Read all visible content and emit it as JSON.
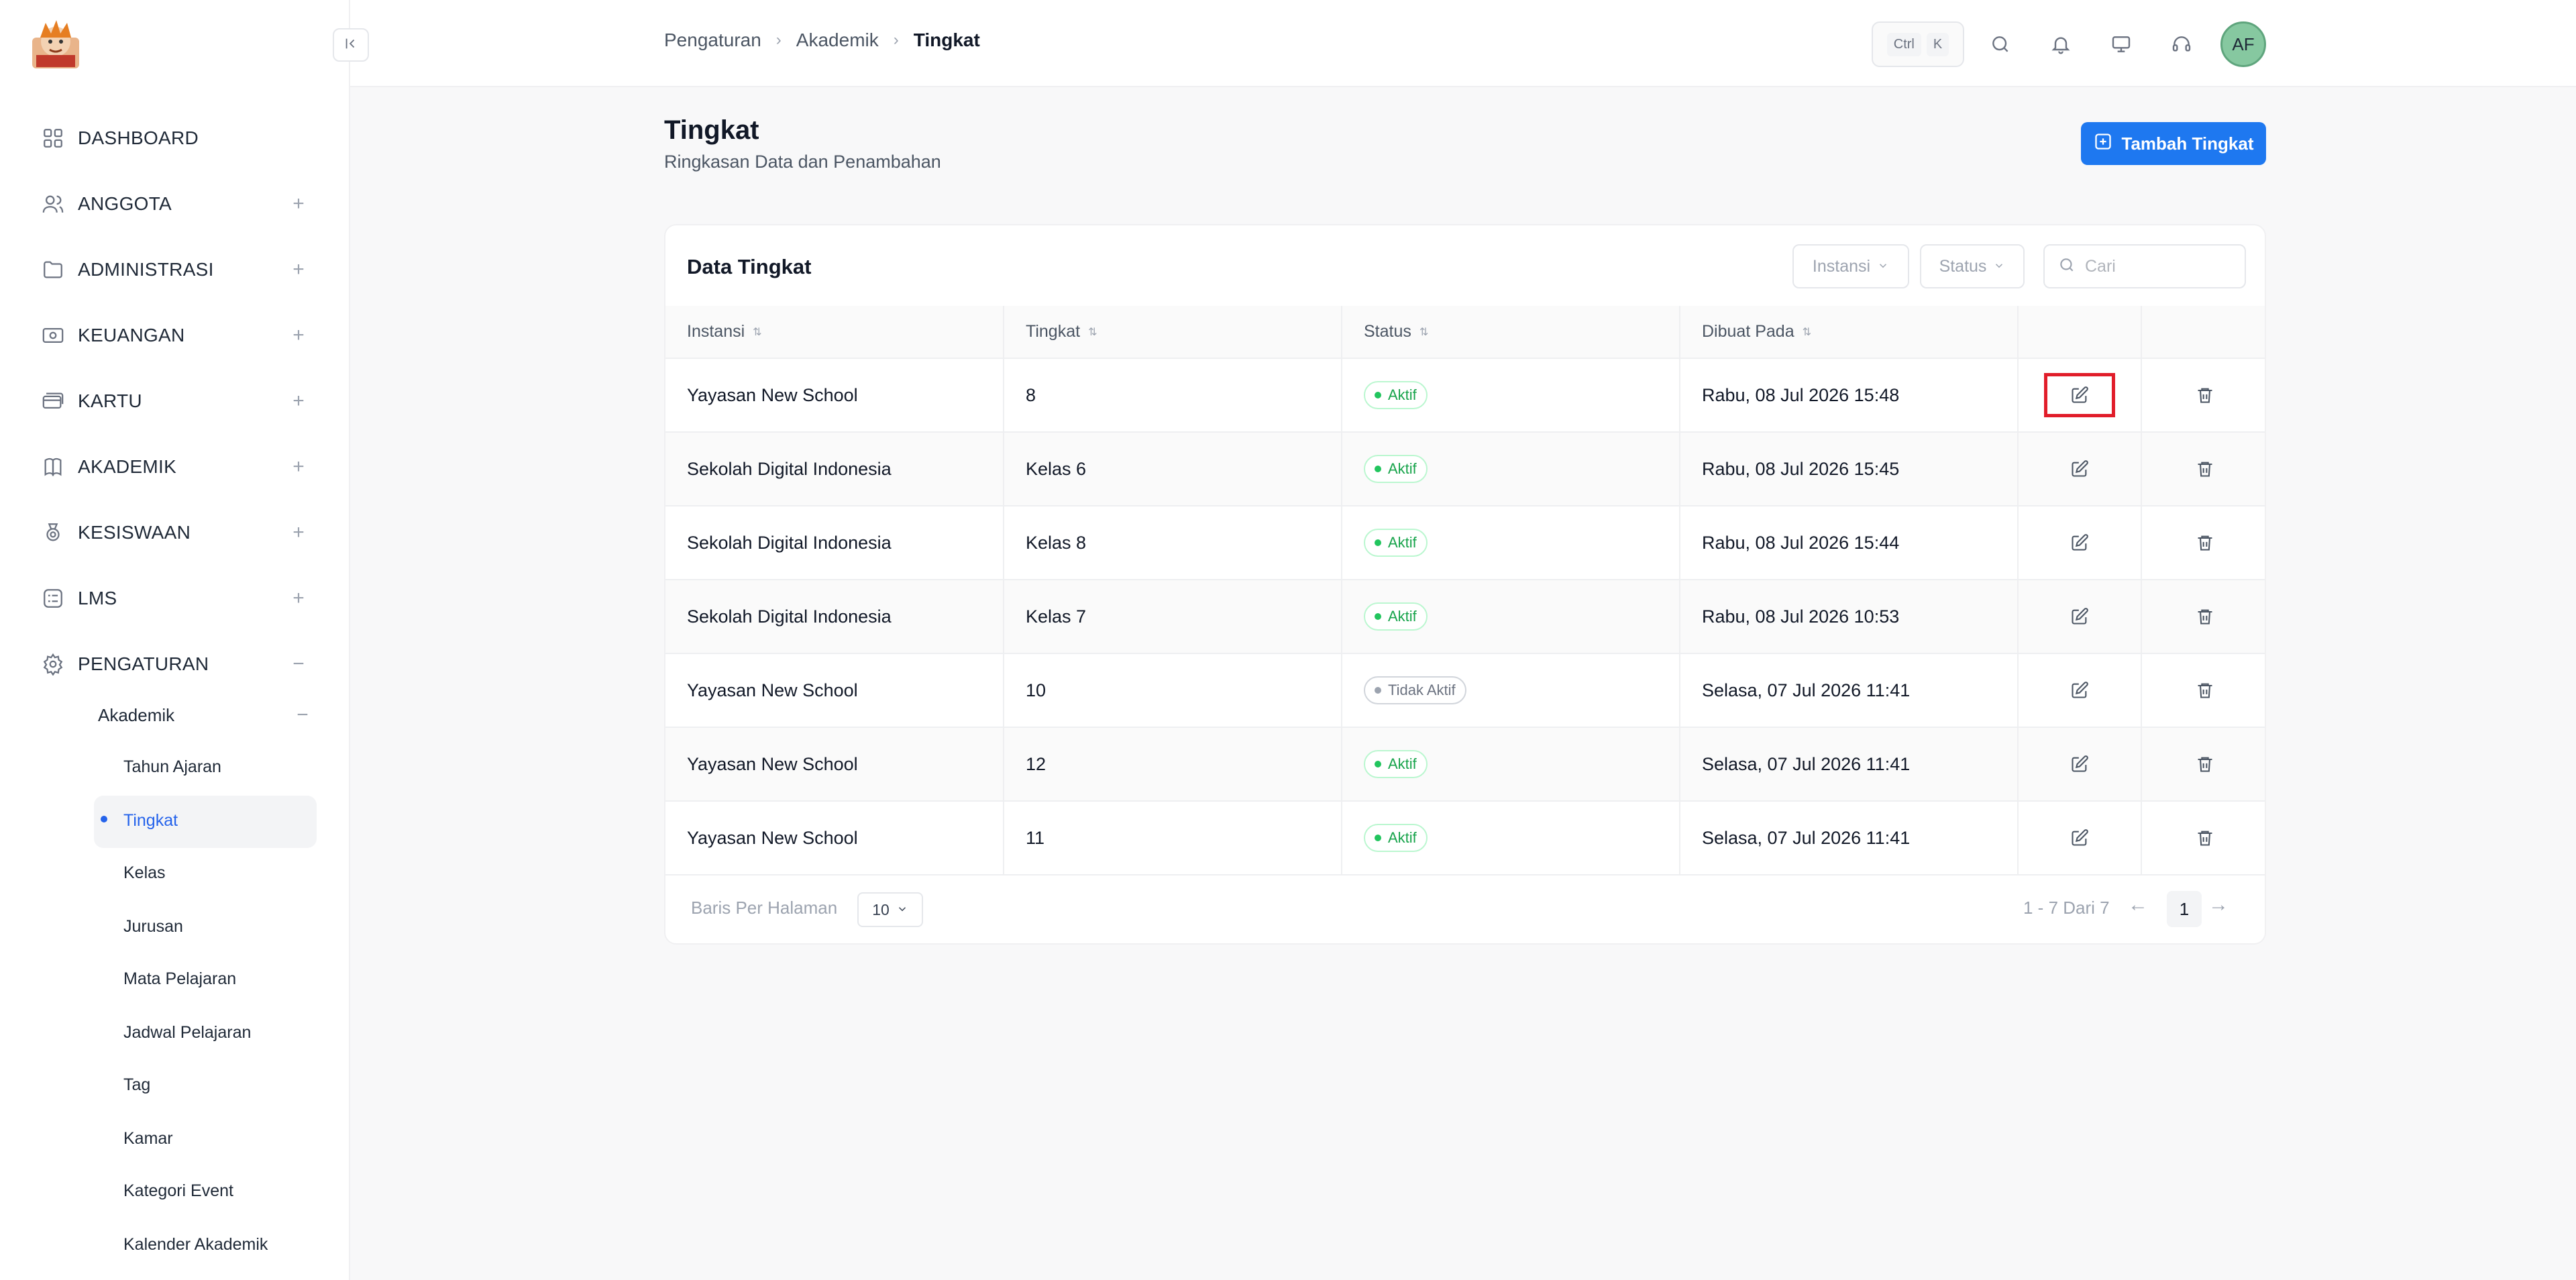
{
  "sidebar": {
    "logo_alt": "logo",
    "items": [
      {
        "label": "DASHBOARD",
        "icon": "grid-icon",
        "toggle": ""
      },
      {
        "label": "ANGGOTA",
        "icon": "users-icon",
        "toggle": "+"
      },
      {
        "label": "ADMINISTRASI",
        "icon": "folder-icon",
        "toggle": "+"
      },
      {
        "label": "KEUANGAN",
        "icon": "money-icon",
        "toggle": "+"
      },
      {
        "label": "KARTU",
        "icon": "cards-icon",
        "toggle": "+"
      },
      {
        "label": "AKADEMIK",
        "icon": "book-icon",
        "toggle": "+"
      },
      {
        "label": "KESISWAAN",
        "icon": "medal-icon",
        "toggle": "+"
      },
      {
        "label": "LMS",
        "icon": "list-icon",
        "toggle": "+"
      },
      {
        "label": "PENGATURAN",
        "icon": "gear-icon",
        "toggle": "−"
      }
    ],
    "sub_group": {
      "label": "Akademik",
      "toggle": "−"
    },
    "leaves": [
      "Tahun Ajaran",
      "Tingkat",
      "Kelas",
      "Jurusan",
      "Mata Pelajaran",
      "Jadwal Pelajaran",
      "Tag",
      "Kamar",
      "Kategori Event",
      "Kalender Akademik"
    ],
    "active_leaf": "Tingkat"
  },
  "topbar": {
    "breadcrumb": [
      "Pengaturan",
      "Akademik",
      "Tingkat"
    ],
    "shortcut_keys": [
      "Ctrl",
      "K"
    ],
    "avatar_initials": "AF"
  },
  "page": {
    "title": "Tingkat",
    "subtitle": "Ringkasan Data dan Penambahan",
    "add_button": "Tambah Tingkat"
  },
  "card": {
    "title": "Data Tingkat",
    "filters": [
      "Instansi",
      "Status"
    ],
    "search_placeholder": "Cari",
    "columns": [
      "Instansi",
      "Tingkat",
      "Status",
      "Dibuat Pada"
    ],
    "rows": [
      {
        "instansi": "Yayasan New School",
        "tingkat": "8",
        "status": "Aktif",
        "dibuat": "Rabu, 08 Jul 2026 15:48"
      },
      {
        "instansi": "Sekolah Digital Indonesia",
        "tingkat": "Kelas 6",
        "status": "Aktif",
        "dibuat": "Rabu, 08 Jul 2026 15:45"
      },
      {
        "instansi": "Sekolah Digital Indonesia",
        "tingkat": "Kelas 8",
        "status": "Aktif",
        "dibuat": "Rabu, 08 Jul 2026 15:44"
      },
      {
        "instansi": "Sekolah Digital Indonesia",
        "tingkat": "Kelas 7",
        "status": "Aktif",
        "dibuat": "Rabu, 08 Jul 2026 10:53"
      },
      {
        "instansi": "Yayasan New School",
        "tingkat": "10",
        "status": "Tidak Aktif",
        "dibuat": "Selasa, 07 Jul 2026 11:41"
      },
      {
        "instansi": "Yayasan New School",
        "tingkat": "12",
        "status": "Aktif",
        "dibuat": "Selasa, 07 Jul 2026 11:41"
      },
      {
        "instansi": "Yayasan New School",
        "tingkat": "11",
        "status": "Aktif",
        "dibuat": "Selasa, 07 Jul 2026 11:41"
      }
    ],
    "footer": {
      "rows_per_page_label": "Baris Per Halaman",
      "rows_per_page_value": "10",
      "range": "1 - 7 Dari 7",
      "current_page": "1",
      "prev_arrow": "←",
      "next_arrow": "→"
    }
  },
  "colors": {
    "accent": "#1e78f0",
    "active": "#16a34a",
    "inactive": "#6b7280",
    "highlight": "#e11d2a"
  }
}
